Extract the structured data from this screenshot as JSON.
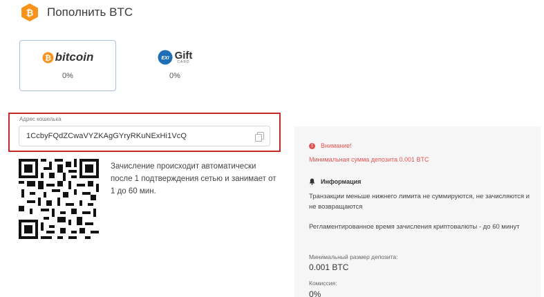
{
  "header": {
    "title": "Пополнить BTC",
    "icon": "bitcoin-hex-icon",
    "accent": "#f7931a"
  },
  "methods": [
    {
      "name": "bitcoin",
      "percent": "0%",
      "selected": true
    },
    {
      "name": "Gift",
      "sub": "CARD",
      "badge": "EXI",
      "percent": "0%",
      "selected": false
    }
  ],
  "wallet": {
    "label": "Адрес кошелька",
    "address": "1CcbyFQdZCwaVYZKAgGYryRKuNExHi1VcQ",
    "copy_icon": "copy-icon",
    "highlight_color": "#c62828"
  },
  "qr_note": "Зачисление происходит автоматически после 1 подтверждения сетью и занимает от 1 до 60 мин.",
  "panel": {
    "warning_title": "Внимание!",
    "warning_text": "Минимальная сумма депозита 0.001 BTC",
    "warning_color": "#e55353",
    "info_title": "Информация",
    "info_text_1": "Транзакции меньше нижнего лимита не суммируются, не зачисляются и не возвращаются",
    "info_text_2": "Регламентированное время зачисления криптовалюты - до 60 минут",
    "min_deposit_label": "Минимальный размер депозита:",
    "min_deposit_value": "0.001 BTC",
    "fee_label": "Комиссия:",
    "fee_value": "0%"
  }
}
